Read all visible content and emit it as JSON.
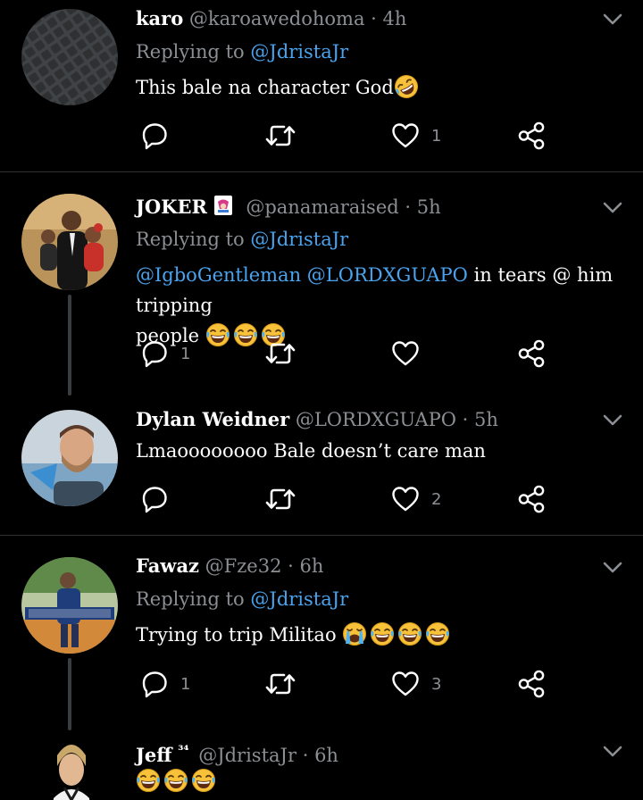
{
  "colors": {
    "background": "#000000",
    "text": "#ffffff",
    "muted": "#8b8f94",
    "link": "#4aa3ee",
    "divider": "#2f3336"
  },
  "tweets": [
    {
      "name": "karo",
      "handle": "@karoawedohoma",
      "dot": "·",
      "time": "4h",
      "replying_prefix": "Replying to",
      "replying_to": "@JdristaJr",
      "text": "This bale na character God",
      "emoji": [
        "rolling-on-floor-laughing-emoji"
      ],
      "reply_count": "",
      "like_count": "1"
    },
    {
      "name": "JOKER",
      "name_badge": "joker-card-icon",
      "handle": "@panamaraised",
      "dot": "·",
      "time": "5h",
      "replying_prefix": "Replying to",
      "replying_to": "@JdristaJr",
      "mention_1": "@IgboGentleman",
      "mention_2": "@LORDXGUAPO",
      "text": "in tears @ him tripping",
      "text_2": "people",
      "emoji": [
        "face-with-tears-of-joy-emoji",
        "face-with-tears-of-joy-emoji",
        "face-with-tears-of-joy-emoji"
      ],
      "reply_count": "1",
      "like_count": ""
    },
    {
      "name": "Dylan Weidner",
      "handle": "@LORDXGUAPO",
      "dot": "·",
      "time": "5h",
      "text": "Lmaoooooooo Bale doesn’t care man",
      "reply_count": "",
      "like_count": "2"
    },
    {
      "name": "Fawaz",
      "handle": "@Fze32",
      "dot": "·",
      "time": "6h",
      "replying_prefix": "Replying to",
      "replying_to": "@JdristaJr",
      "text": "Trying to trip Militao",
      "emoji": [
        "loudly-crying-face-emoji",
        "face-with-tears-of-joy-emoji",
        "face-with-tears-of-joy-emoji",
        "face-with-tears-of-joy-emoji"
      ],
      "reply_count": "1",
      "like_count": "3"
    },
    {
      "name": "Jeff",
      "name_sup": "³⁴",
      "handle": "@JdristaJr",
      "dot": "·",
      "time": "6h",
      "emoji": [
        "face-with-tears-of-joy-emoji",
        "face-with-tears-of-joy-emoji",
        "face-with-tears-of-joy-emoji"
      ]
    }
  ]
}
